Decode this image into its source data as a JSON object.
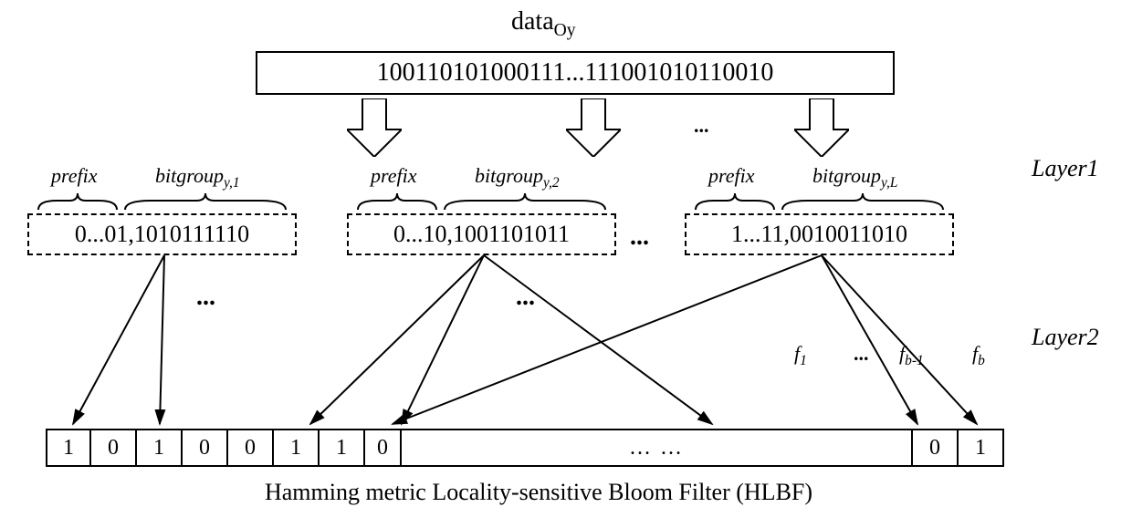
{
  "title_prefix": "data",
  "title_sub": "Oy",
  "input_bits": "100110101000111...111001010110010",
  "layer1_label": "Layer1",
  "layer2_label": "Layer2",
  "prefix_label": "prefix",
  "bitgroup_label_prefix": "bitgroup",
  "groups": [
    {
      "sub": "y,1",
      "content": "0...01,1010111110"
    },
    {
      "sub": "y,2",
      "content": "0...10,1001101011"
    },
    {
      "sub": "y,L",
      "content": "1...11,0010011010"
    }
  ],
  "group_ellipsis": "...",
  "dots_label": "...",
  "hash_labels": {
    "f1": "f",
    "f1_sub": "1",
    "fb1": "f",
    "fb1_sub": "b-1",
    "fb": "f",
    "fb_sub": "b"
  },
  "hlbf_cells_left": [
    "1",
    "0",
    "1",
    "0",
    "0",
    "1",
    "1",
    "0"
  ],
  "hlbf_mid": "… …",
  "hlbf_cells_right": [
    "0",
    "1"
  ],
  "caption": "Hamming metric Locality-sensitive Bloom Filter (HLBF)"
}
